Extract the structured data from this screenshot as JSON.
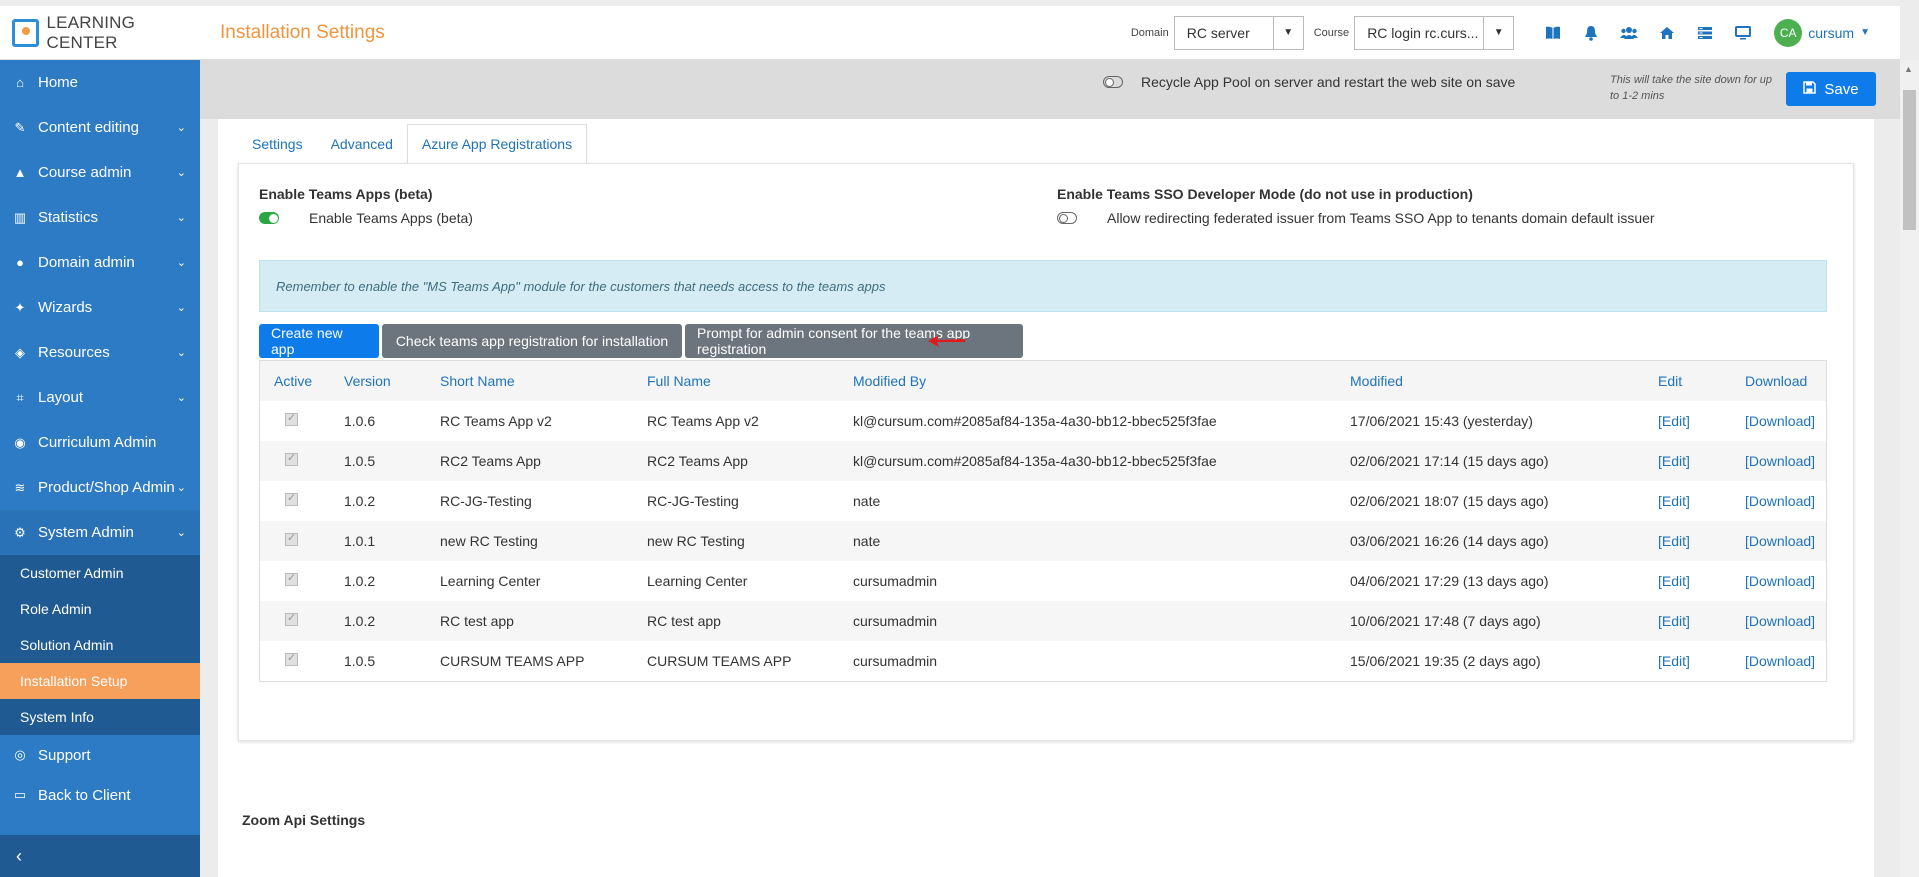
{
  "header": {
    "brand": "LEARNING CENTER",
    "page_title": "Installation Settings",
    "domain_label": "Domain",
    "domain_value": "RC server",
    "course_label": "Course",
    "course_value": "RC login rc.curs...",
    "avatar_initials": "CA",
    "user_name": "cursum",
    "icons": [
      "book-icon",
      "bell-icon",
      "users-icon",
      "home-icon",
      "list-icon",
      "monitor-icon"
    ]
  },
  "sidebar": {
    "items": [
      {
        "label": "Home",
        "icon": "home-icon"
      },
      {
        "label": "Content editing",
        "icon": "edit-icon"
      },
      {
        "label": "Course admin",
        "icon": "graduation-cap-icon"
      },
      {
        "label": "Statistics",
        "icon": "bar-chart-icon"
      },
      {
        "label": "Domain admin",
        "icon": "globe-icon"
      },
      {
        "label": "Wizards",
        "icon": "magic-wand-icon"
      },
      {
        "label": "Resources",
        "icon": "cube-icon"
      },
      {
        "label": "Layout",
        "icon": "crop-icon"
      },
      {
        "label": "Curriculum Admin",
        "icon": "user-circle-icon"
      },
      {
        "label": "Product/Shop Admin",
        "icon": "database-icon"
      },
      {
        "label": "System Admin",
        "icon": "users-cog-icon"
      }
    ],
    "sub_items": [
      {
        "label": "Customer Admin"
      },
      {
        "label": "Role Admin"
      },
      {
        "label": "Solution Admin"
      },
      {
        "label": "Installation Setup"
      },
      {
        "label": "System Info"
      }
    ],
    "bottom_items": [
      {
        "label": "Support",
        "icon": "support-icon"
      },
      {
        "label": "Back to Client",
        "icon": "desktop-icon"
      }
    ]
  },
  "savebar": {
    "recycle_label": "Recycle App Pool on server and restart the web site on save",
    "note": "This will take the site down for up to 1-2 mins",
    "save_label": "Save"
  },
  "tabs": [
    {
      "label": "Settings"
    },
    {
      "label": "Advanced"
    },
    {
      "label": "Azure App Registrations"
    }
  ],
  "teams": {
    "enable_heading": "Enable Teams Apps (beta)",
    "enable_toggle_label": "Enable Teams Apps (beta)",
    "sso_heading": "Enable Teams SSO Developer Mode (do not use in production)",
    "sso_toggle_label": "Allow redirecting federated issuer from Teams SSO App to tenants domain default issuer",
    "info": "Remember to enable the \"MS Teams App\" module for the customers that needs access to the teams apps",
    "btn_create": "Create new app",
    "btn_check": "Check teams app registration for installation",
    "btn_prompt": "Prompt for admin consent for the teams app registration"
  },
  "table": {
    "headers": {
      "active": "Active",
      "version": "Version",
      "short": "Short Name",
      "full": "Full Name",
      "modby": "Modified By",
      "mod": "Modified",
      "edit": "Edit",
      "download": "Download"
    },
    "rows": [
      {
        "version": "1.0.6",
        "short": "RC Teams App v2",
        "full": "RC Teams App v2",
        "modby": "kl@cursum.com#2085af84-135a-4a30-bb12-bbec525f3fae",
        "mod": "17/06/2021 15:43 (yesterday)",
        "edit": "[Edit]",
        "download": "[Download]"
      },
      {
        "version": "1.0.5",
        "short": "RC2 Teams App",
        "full": "RC2 Teams App",
        "modby": "kl@cursum.com#2085af84-135a-4a30-bb12-bbec525f3fae",
        "mod": "02/06/2021 17:14 (15 days ago)",
        "edit": "[Edit]",
        "download": "[Download]"
      },
      {
        "version": "1.0.2",
        "short": "RC-JG-Testing",
        "full": "RC-JG-Testing",
        "modby": "nate",
        "mod": "02/06/2021 18:07 (15 days ago)",
        "edit": "[Edit]",
        "download": "[Download]"
      },
      {
        "version": "1.0.1",
        "short": "new RC Testing",
        "full": "new RC Testing",
        "modby": "nate",
        "mod": "03/06/2021 16:26 (14 days ago)",
        "edit": "[Edit]",
        "download": "[Download]"
      },
      {
        "version": "1.0.2",
        "short": "Learning Center",
        "full": "Learning Center",
        "modby": "cursumadmin",
        "mod": "04/06/2021 17:29 (13 days ago)",
        "edit": "[Edit]",
        "download": "[Download]"
      },
      {
        "version": "1.0.2",
        "short": "RC test app",
        "full": "RC test app",
        "modby": "cursumadmin",
        "mod": "10/06/2021 17:48 (7 days ago)",
        "edit": "[Edit]",
        "download": "[Download]"
      },
      {
        "version": "1.0.5",
        "short": "CURSUM TEAMS APP",
        "full": "CURSUM TEAMS APP",
        "modby": "cursumadmin",
        "mod": "15/06/2021 19:35 (2 days ago)",
        "edit": "[Edit]",
        "download": "[Download]"
      }
    ]
  },
  "zoom": {
    "title": "Zoom Api Settings"
  },
  "colors": {
    "sidebar": "#2d7bc4",
    "sidebar_active": "#f6a05c",
    "primary": "#0d7bea",
    "title_orange": "#f0943d"
  }
}
